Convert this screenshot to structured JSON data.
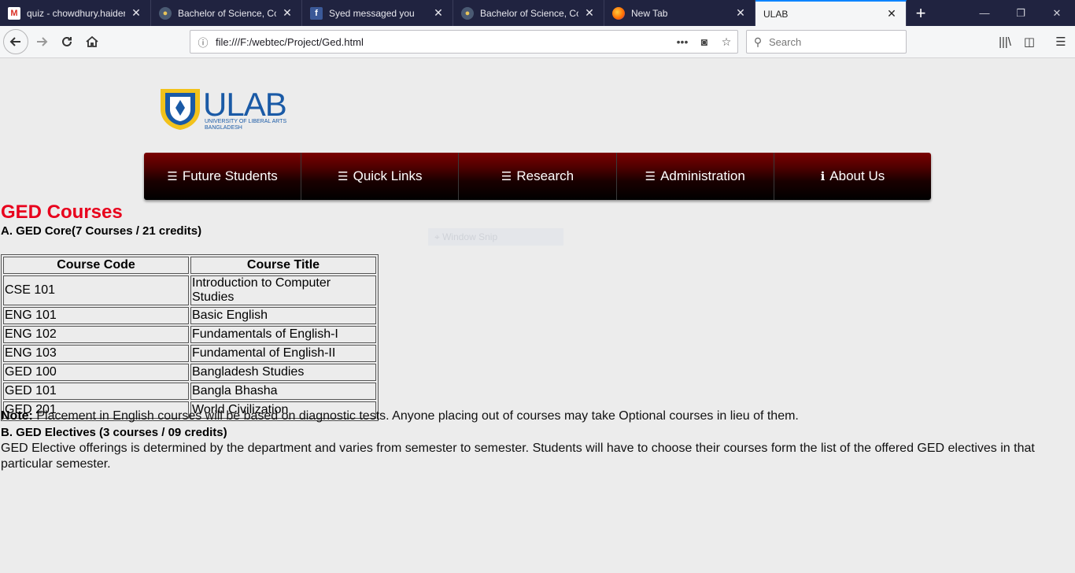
{
  "browser": {
    "tabs": [
      {
        "title": "quiz - chowdhury.haider",
        "icon": "gmail-icon"
      },
      {
        "title": "Bachelor of Science, Com",
        "icon": "ulab-icon"
      },
      {
        "title": "Syed messaged you",
        "icon": "facebook-icon"
      },
      {
        "title": "Bachelor of Science, Com",
        "icon": "ulab-icon"
      },
      {
        "title": "New Tab",
        "icon": "firefox-icon"
      },
      {
        "title": "ULAB",
        "icon": ""
      }
    ],
    "active_tab": 5,
    "url": "file:///F:/webtec/Project/Ged.html",
    "search_placeholder": "Search"
  },
  "site": {
    "logo_text": "ULAB",
    "logo_subtitle_1": "UNIVERSITY OF LIBERAL ARTS",
    "logo_subtitle_2": "BANGLADESH",
    "menu": [
      {
        "label": "Future Students",
        "icon": "list-icon"
      },
      {
        "label": "Quick Links",
        "icon": "list-icon"
      },
      {
        "label": "Research",
        "icon": "list-icon"
      },
      {
        "label": "Administration",
        "icon": "list-icon"
      },
      {
        "label": "About Us",
        "icon": "info-icon"
      }
    ]
  },
  "content": {
    "title": "GED Courses",
    "section_a": "A. GED Core(7 Courses / 21 credits)",
    "ghost_text": "Window Snip",
    "table": {
      "headers": [
        "Course Code",
        "Course Title"
      ],
      "rows": [
        [
          "CSE 101",
          "Introduction to Computer Studies"
        ],
        [
          "ENG 101",
          "Basic English"
        ],
        [
          "ENG 102",
          "Fundamentals of English-I"
        ],
        [
          "ENG 103",
          "Fundamental of English-II"
        ],
        [
          "GED 100",
          "Bangladesh Studies"
        ],
        [
          "GED 101",
          "Bangla Bhasha"
        ],
        [
          "GED 201",
          "World Civilization"
        ]
      ]
    },
    "note_label": "Note:",
    "note_text": " Placement in English courses will be based on diagnostic tests. Anyone placing out of courses may take Optional courses in lieu of them.",
    "section_b": "B. GED Electives (3 courses / 09 credits)",
    "electives_text": "GED Elective offerings is determined by the department and varies from semester to semester. Students will have to choose their courses form the list of the offered GED electives in that particular semester."
  },
  "colors": {
    "title_red": "#e8001c",
    "menu_dark_red": "#7a0000",
    "tabbar_bg": "#202340",
    "logo_blue": "#1a5aa6"
  }
}
